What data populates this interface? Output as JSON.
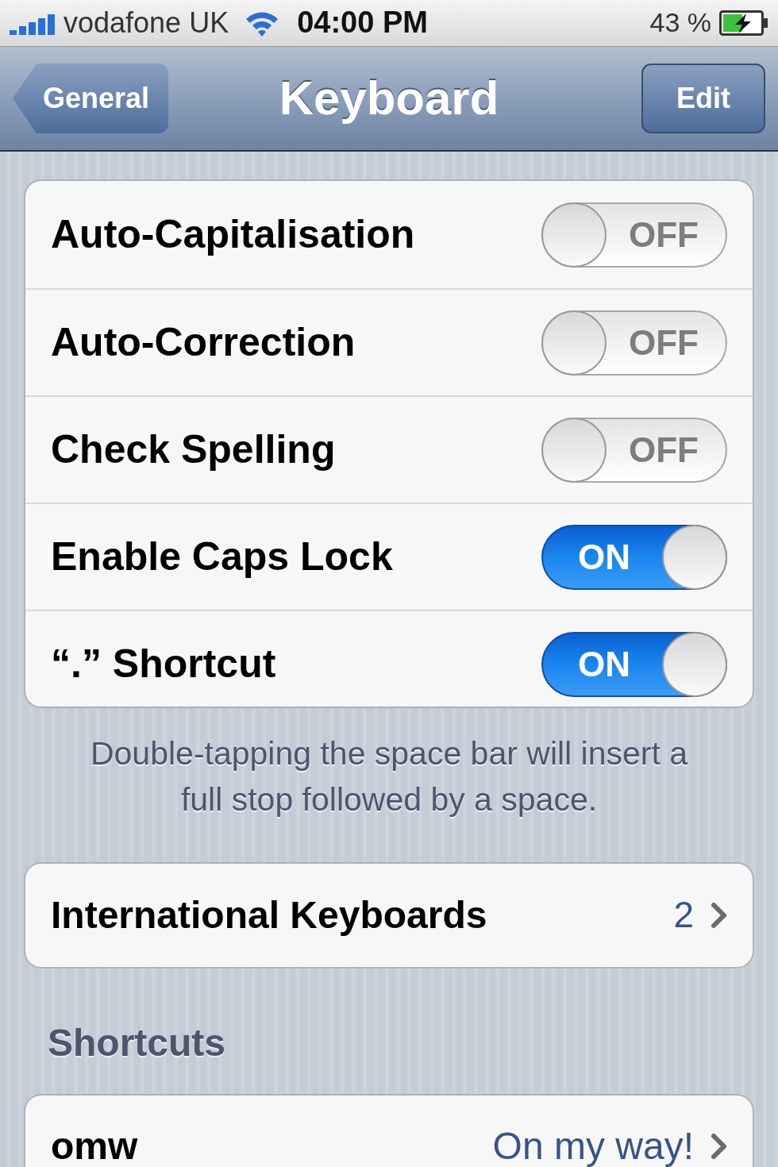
{
  "status_bar": {
    "carrier": "vodafone UK",
    "time": "04:00 PM",
    "battery": "43 %"
  },
  "nav": {
    "back": "General",
    "title": "Keyboard",
    "action": "Edit"
  },
  "settings": [
    {
      "label": "Auto-Capitalisation",
      "on": false,
      "switch_text": "OFF"
    },
    {
      "label": "Auto-Correction",
      "on": false,
      "switch_text": "OFF"
    },
    {
      "label": "Check Spelling",
      "on": false,
      "switch_text": "OFF"
    },
    {
      "label": "Enable Caps Lock",
      "on": true,
      "switch_text": "ON"
    },
    {
      "label": "“.” Shortcut",
      "on": true,
      "switch_text": "ON"
    }
  ],
  "footer": "Double-tapping the space bar will insert a full stop followed by a space.",
  "international": {
    "label": "International Keyboards",
    "value": "2"
  },
  "section_header": "Shortcuts",
  "shortcuts": [
    {
      "phrase": "omw",
      "expansion": "On my way!"
    }
  ]
}
